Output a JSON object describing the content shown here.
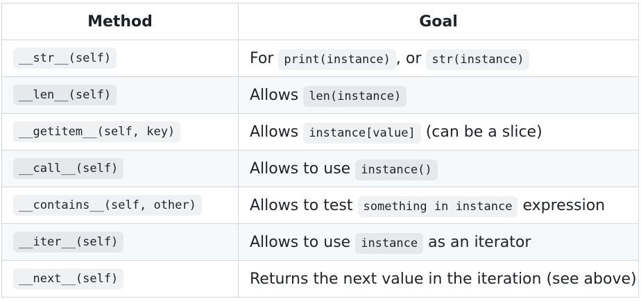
{
  "headers": {
    "method": "Method",
    "goal": "Goal"
  },
  "rows": [
    {
      "method": "__str__(self)",
      "goal": [
        {
          "t": "text",
          "v": "For "
        },
        {
          "t": "code",
          "v": "print(instance)"
        },
        {
          "t": "text",
          "v": ", or "
        },
        {
          "t": "code",
          "v": "str(instance)"
        }
      ]
    },
    {
      "method": "__len__(self)",
      "goal": [
        {
          "t": "text",
          "v": "Allows "
        },
        {
          "t": "code",
          "v": "len(instance)"
        }
      ]
    },
    {
      "method": "__getitem__(self, key)",
      "goal": [
        {
          "t": "text",
          "v": "Allows "
        },
        {
          "t": "code",
          "v": "instance[value]"
        },
        {
          "t": "text",
          "v": " (can be a slice)"
        }
      ]
    },
    {
      "method": "__call__(self)",
      "goal": [
        {
          "t": "text",
          "v": "Allows to use "
        },
        {
          "t": "code",
          "v": "instance()"
        }
      ]
    },
    {
      "method": "__contains__(self, other)",
      "goal": [
        {
          "t": "text",
          "v": "Allows to test "
        },
        {
          "t": "code",
          "v": "something in instance"
        },
        {
          "t": "text",
          "v": " expression"
        }
      ]
    },
    {
      "method": "__iter__(self)",
      "goal": [
        {
          "t": "text",
          "v": "Allows to use "
        },
        {
          "t": "code",
          "v": "instance"
        },
        {
          "t": "text",
          "v": " as an iterator"
        }
      ]
    },
    {
      "method": "__next__(self)",
      "goal": [
        {
          "t": "text",
          "v": "Returns the next value in the iteration (see above)"
        }
      ]
    }
  ]
}
